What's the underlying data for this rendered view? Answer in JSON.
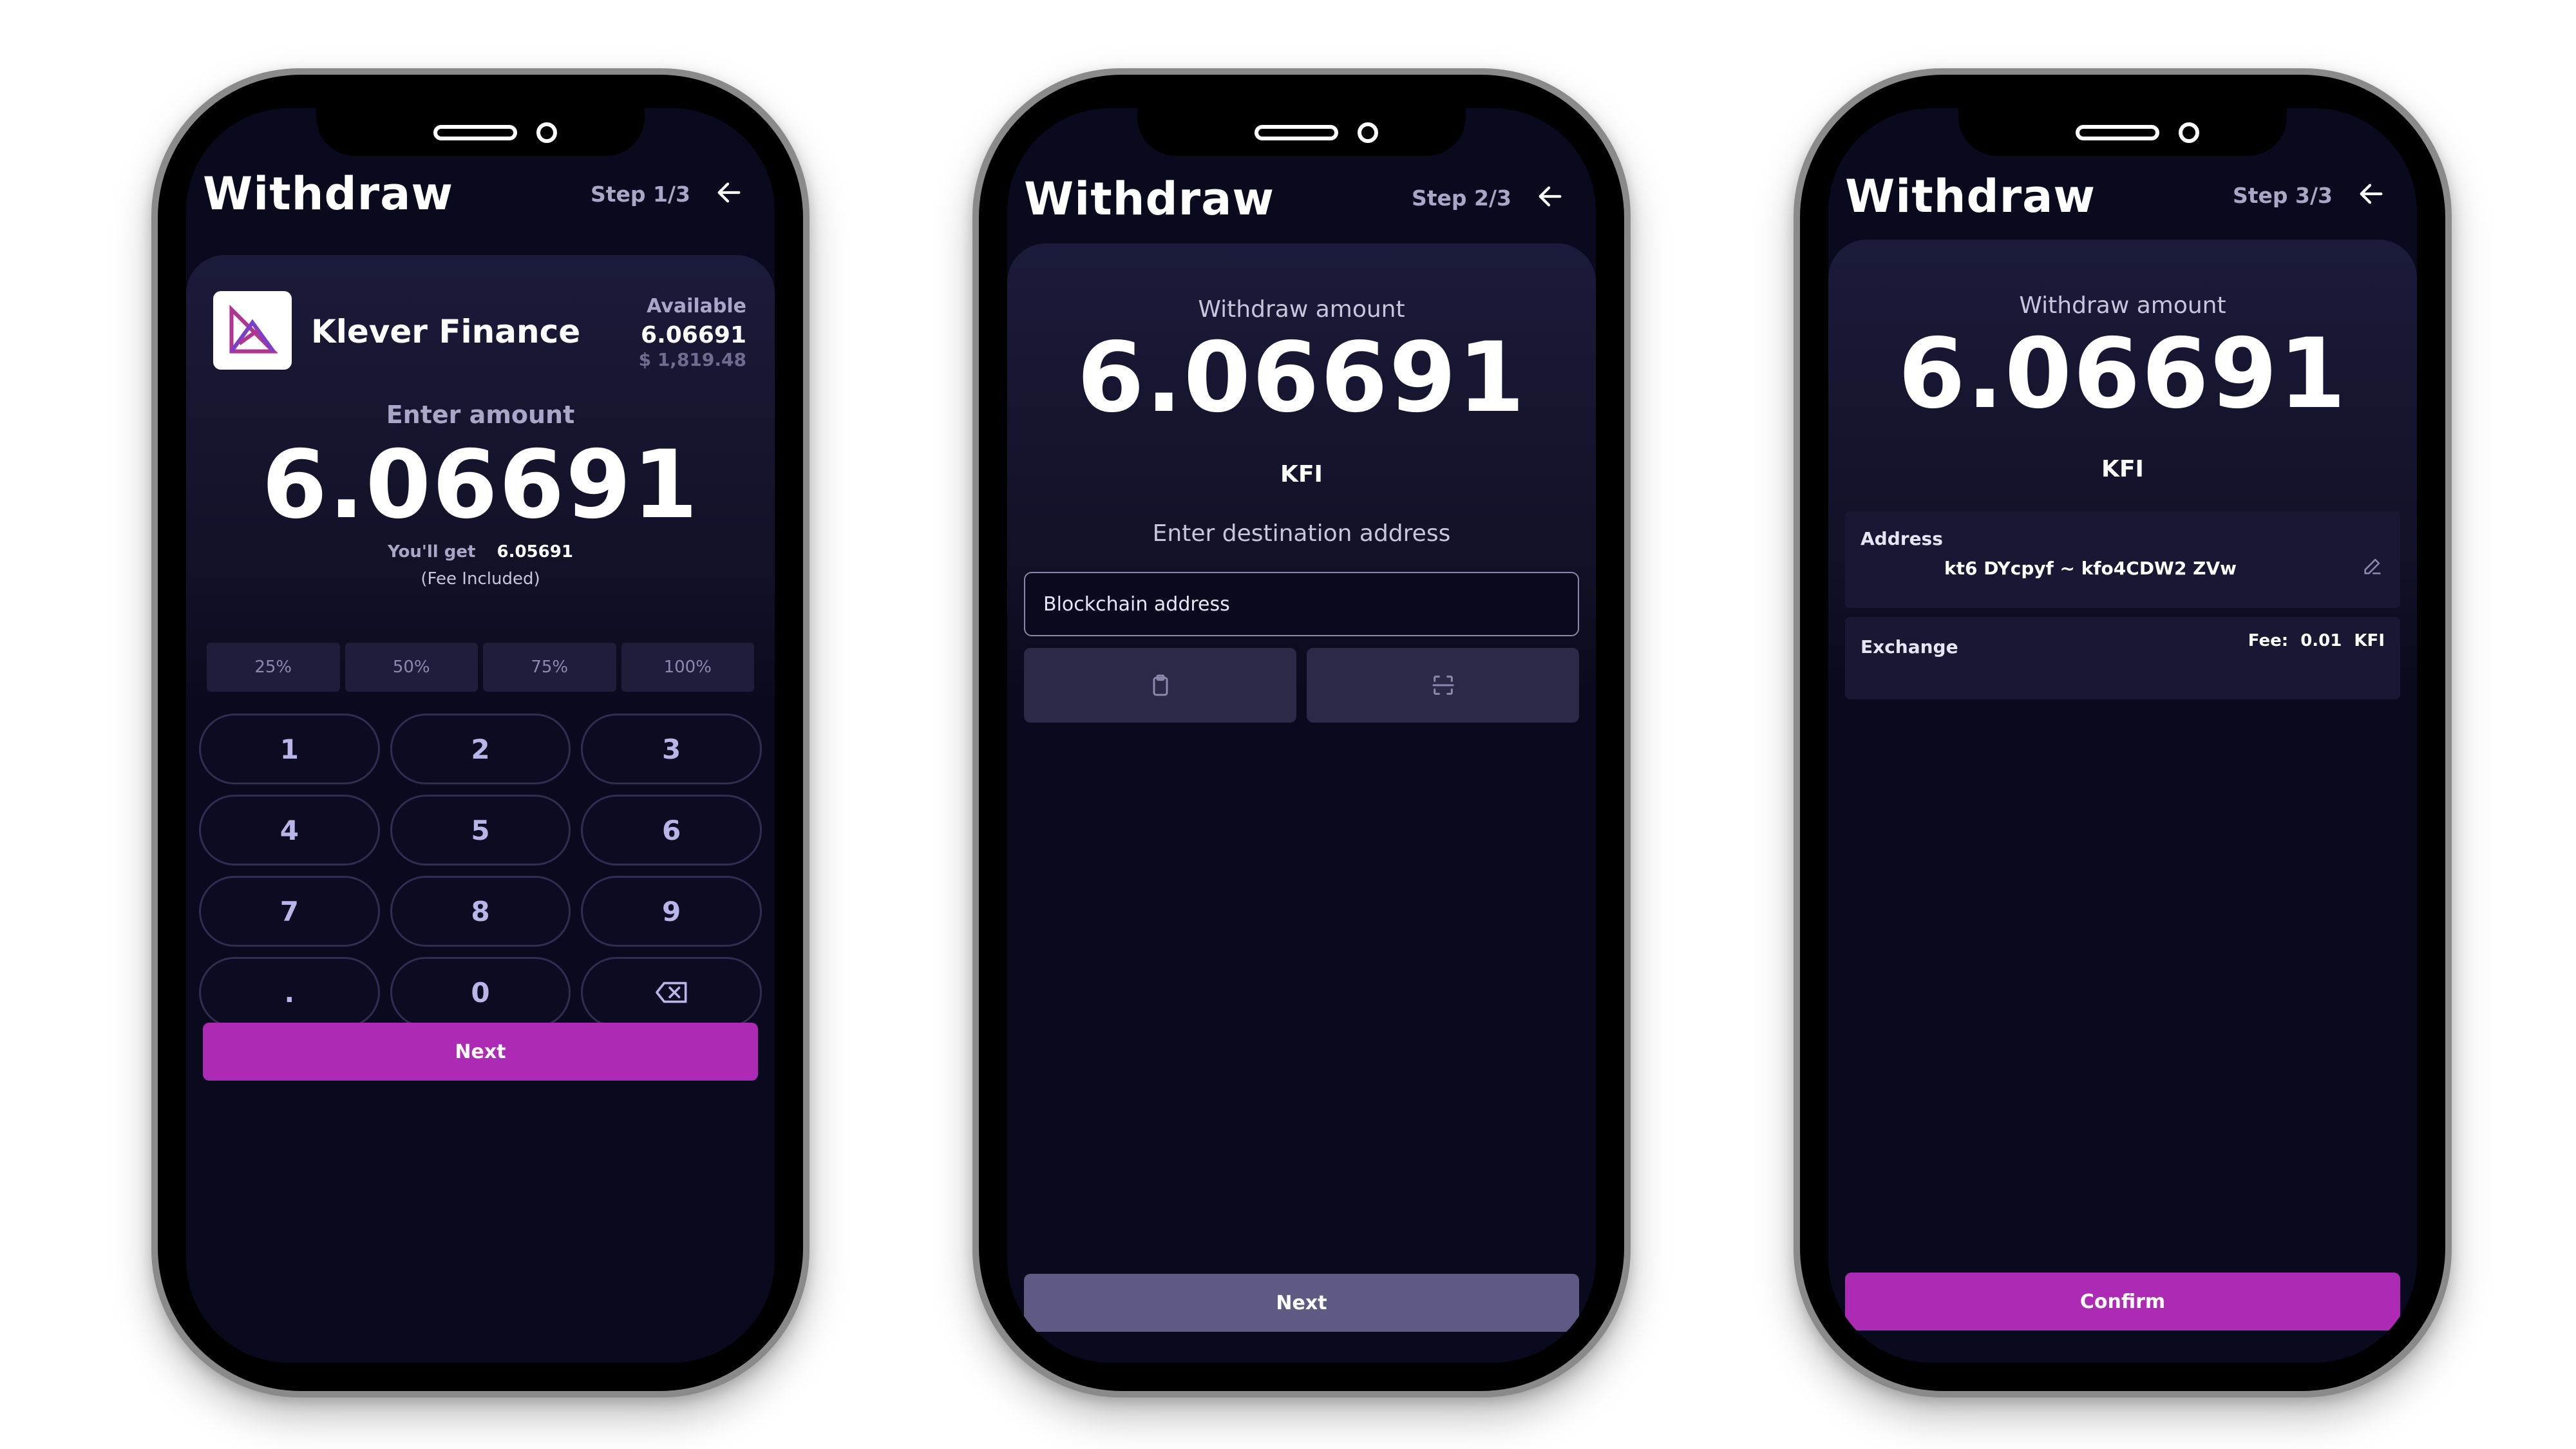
{
  "screens": [
    {
      "title": "Withdraw",
      "step": "Step 1/3",
      "asset": {
        "name": "Klever Finance",
        "available_label": "Available",
        "available_amount": "6.06691",
        "available_usd": "$ 1,819.48"
      },
      "enter_label": "Enter amount",
      "amount": "6.06691",
      "you_get_label": "You'll get",
      "you_get_value": "6.05691",
      "fee_note": "(Fee Included)",
      "percent_buttons": [
        "25%",
        "50%",
        "75%",
        "100%"
      ],
      "keys": [
        "1",
        "2",
        "3",
        "4",
        "5",
        "6",
        "7",
        "8",
        "9",
        ".",
        "0"
      ],
      "next_label": "Next"
    },
    {
      "title": "Withdraw",
      "step": "Step 2/3",
      "withdraw_label": "Withdraw amount",
      "amount": "6.06691",
      "unit": "KFI",
      "destination_label": "Enter destination address",
      "address_placeholder": "Blockchain address",
      "next_label": "Next"
    },
    {
      "title": "Withdraw",
      "step": "Step 3/3",
      "withdraw_label": "Withdraw amount",
      "amount": "6.06691",
      "unit": "KFI",
      "address_label": "Address",
      "address_value": "kt6  DYcpyf  ~  kfo4CDW2  ZVw",
      "exchange_label": "Exchange",
      "fee_label": "Fee:",
      "fee_value": "0.01",
      "fee_unit": "KFI",
      "confirm_label": "Confirm"
    }
  ],
  "colors": {
    "background": "#0a0a1e",
    "card": "#1b1a3a",
    "accent_purple": "#ac2ab4",
    "button_slate": "#5d5b84",
    "muted_text": "#a9a6c7"
  },
  "icons": {
    "back": "arrow-left-icon",
    "brand": "klever-logo-icon",
    "backspace": "backspace-icon",
    "paste": "clipboard-icon",
    "scan": "qr-scan-icon",
    "edit": "pencil-icon"
  }
}
